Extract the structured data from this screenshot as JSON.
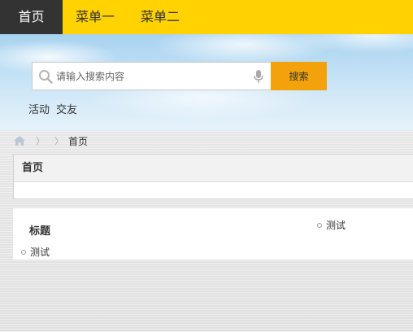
{
  "nav": {
    "items": [
      {
        "label": "首页",
        "active": true
      },
      {
        "label": "菜单一",
        "active": false
      },
      {
        "label": "菜单二",
        "active": false
      }
    ],
    "bar_color": "#ffd200",
    "active_color": "#333333"
  },
  "search": {
    "placeholder": "请输入搜索内容",
    "button_label": "搜索",
    "button_color": "#f4a20c",
    "icons": [
      "search-icon",
      "mic-icon"
    ]
  },
  "quick_links": [
    "活动",
    "交友"
  ],
  "breadcrumb": {
    "current": "首页",
    "icon": "home-icon"
  },
  "page_title": "首页",
  "content": {
    "section_title": "标题",
    "items": [
      "测试",
      "测试"
    ]
  }
}
